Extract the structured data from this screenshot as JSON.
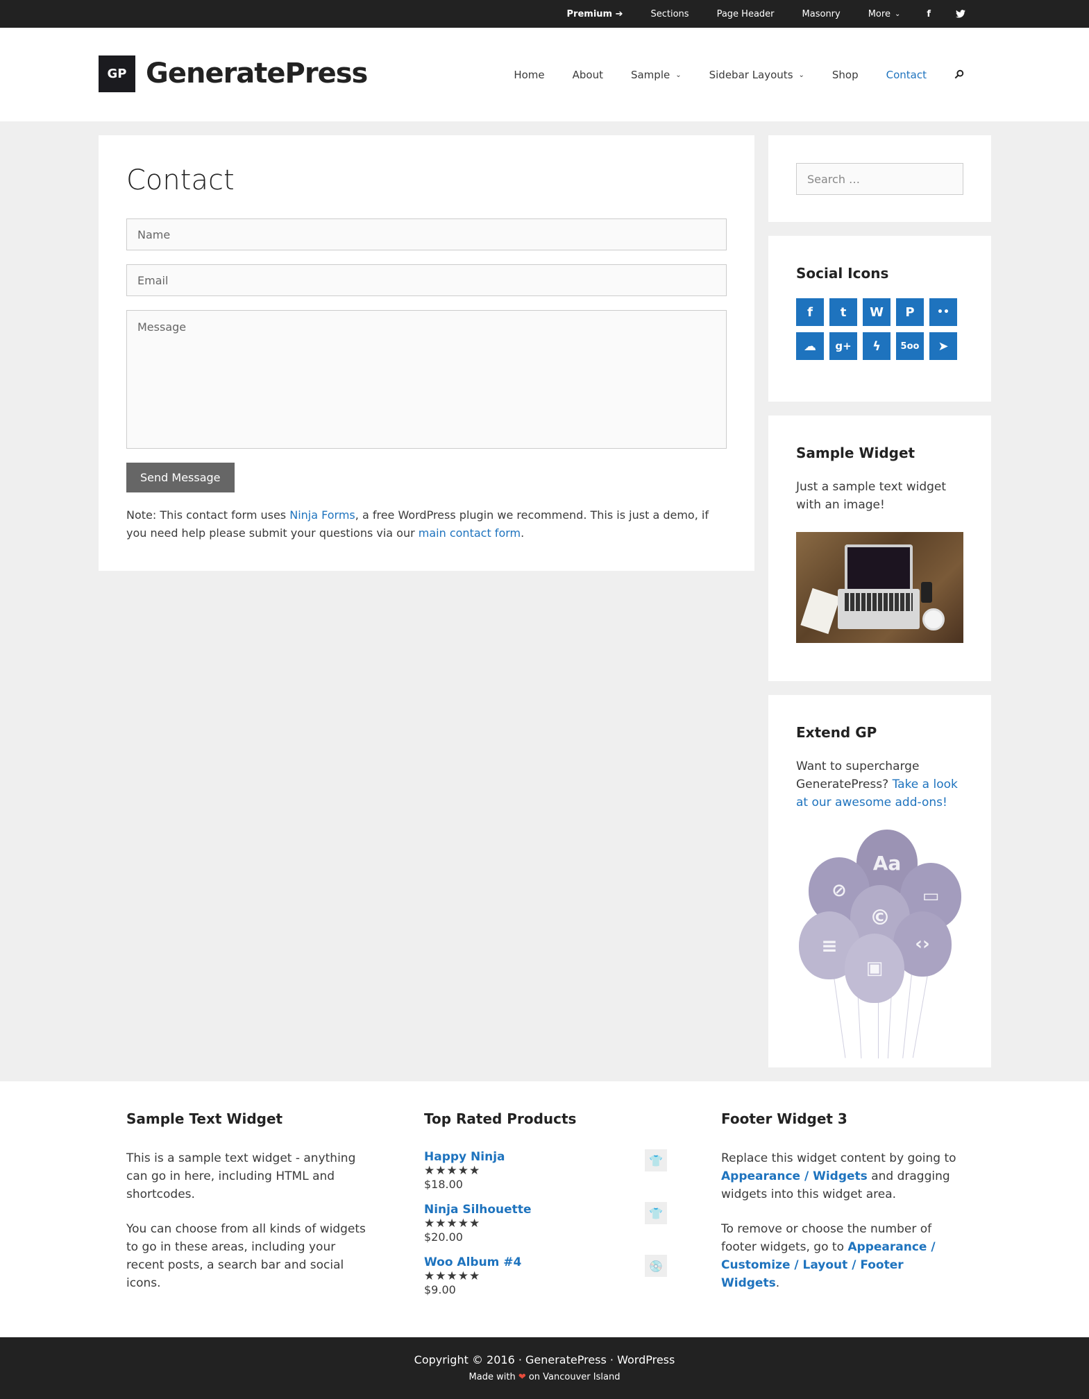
{
  "topbar": {
    "items": [
      {
        "label": "Premium ➔"
      },
      {
        "label": "Sections"
      },
      {
        "label": "Page Header"
      },
      {
        "label": "Masonry"
      },
      {
        "label": "More"
      }
    ],
    "social": [
      {
        "icon": "facebook-icon",
        "glyph": "f"
      },
      {
        "icon": "twitter-icon",
        "glyph": "🐦"
      }
    ]
  },
  "header": {
    "logo_text": "GP",
    "site_title": "GeneratePress",
    "nav": [
      {
        "label": "Home"
      },
      {
        "label": "About"
      },
      {
        "label": "Sample"
      },
      {
        "label": "Sidebar Layouts"
      },
      {
        "label": "Shop"
      },
      {
        "label": "Contact"
      }
    ]
  },
  "content": {
    "title": "Contact",
    "name_placeholder": "Name",
    "email_placeholder": "Email",
    "message_placeholder": "Message",
    "send_label": "Send Message",
    "note_prefix": "Note: This contact form uses ",
    "note_link1": "Ninja Forms",
    "note_middle": ", a free WordPress plugin we recommend. This is just a demo, if you need help please submit your questions via our ",
    "note_link2": "main contact form",
    "note_suffix": "."
  },
  "sidebar": {
    "search_placeholder": "Search …",
    "social_title": "Social Icons",
    "social_icons": [
      {
        "name": "facebook-icon",
        "glyph": "f"
      },
      {
        "name": "twitter-icon",
        "glyph": "t"
      },
      {
        "name": "wordpress-icon",
        "glyph": "W"
      },
      {
        "name": "pinterest-icon",
        "glyph": "P"
      },
      {
        "name": "flickr-icon",
        "glyph": "••"
      },
      {
        "name": "soundcloud-icon",
        "glyph": "☁"
      },
      {
        "name": "google-plus-icon",
        "glyph": "g+"
      },
      {
        "name": "deviantart-icon",
        "glyph": "ϟ"
      },
      {
        "name": "500px-icon",
        "glyph": "5oo"
      },
      {
        "name": "telegram-icon",
        "glyph": "➤"
      }
    ],
    "sample_title": "Sample Widget",
    "sample_text": "Just a sample text widget with an image!",
    "extend_title": "Extend GP",
    "extend_text": "Want to supercharge GeneratePress? ",
    "extend_link": "Take a look at our awesome add-ons!",
    "balloon_text": "Aa"
  },
  "footer_widgets": {
    "col1": {
      "title": "Sample Text Widget",
      "p1": "This is a sample text widget - anything can go in here, including HTML and shortcodes.",
      "p2": "You can choose from all kinds of widgets to go in these areas, including your recent posts, a search bar and social icons."
    },
    "col2": {
      "title": "Top Rated Products",
      "products": [
        {
          "name": "Happy Ninja",
          "stars": "★★★★★",
          "rating": 5,
          "price": "$18.00",
          "thumb": "👕"
        },
        {
          "name": "Ninja Silhouette",
          "stars": "★★★★★",
          "rating": 5,
          "price": "$20.00",
          "thumb": "👕"
        },
        {
          "name": "Woo Album #4",
          "stars": "★★★★★",
          "rating": 5,
          "price": "$9.00",
          "thumb": "💿"
        }
      ]
    },
    "col3": {
      "title": "Footer Widget 3",
      "p1_prefix": "Replace this widget content by going to ",
      "p1_link": "Appearance / Widgets",
      "p1_suffix": " and dragging widgets into this widget area.",
      "p2_prefix": "To remove or choose the number of footer widgets, go to ",
      "p2_link": "Appearance / Customize / Layout / Footer Widgets",
      "p2_suffix": "."
    }
  },
  "footer": {
    "copyright": "Copyright © 2016 · GeneratePress · WordPress",
    "made_prefix": "Made with ",
    "heart": "❤",
    "made_suffix": " on Vancouver Island"
  },
  "colors": {
    "accent": "#1e73be",
    "dark": "#222222",
    "background": "#efefef"
  }
}
